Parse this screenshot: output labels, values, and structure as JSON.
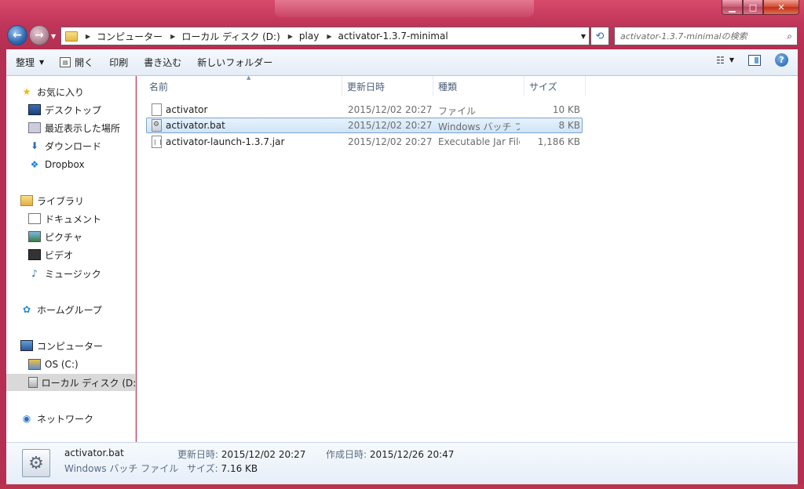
{
  "address": {
    "crumbs": [
      "コンピューター",
      "ローカル ディスク (D:)",
      "play",
      "activator-1.3.7-minimal"
    ]
  },
  "search": {
    "placeholder": "activator-1.3.7-minimalの検索"
  },
  "toolbar": {
    "organize": "整理",
    "open": "開く",
    "print": "印刷",
    "burn": "書き込む",
    "new_folder": "新しいフォルダー"
  },
  "nav": {
    "favorites": "お気に入り",
    "desktop": "デスクトップ",
    "recent": "最近表示した場所",
    "downloads": "ダウンロード",
    "dropbox": "Dropbox",
    "libraries": "ライブラリ",
    "documents": "ドキュメント",
    "pictures": "ピクチャ",
    "videos": "ビデオ",
    "music": "ミュージック",
    "homegroup": "ホームグループ",
    "computer": "コンピューター",
    "os_drive": "OS (C:)",
    "local_disk": "ローカル ディスク (D:)",
    "network": "ネットワーク"
  },
  "columns": {
    "name": "名前",
    "date": "更新日時",
    "type": "種類",
    "size": "サイズ"
  },
  "files": [
    {
      "name": "activator",
      "date": "2015/12/02 20:27",
      "type": "ファイル",
      "size": "10 KB",
      "icon": "generic-file-icon"
    },
    {
      "name": "activator.bat",
      "date": "2015/12/02 20:27",
      "type": "Windows バッチ ファイル",
      "size": "8 KB",
      "icon": "batch-file-icon"
    },
    {
      "name": "activator-launch-1.3.7.jar",
      "date": "2015/12/02 20:27",
      "type": "Executable Jar File",
      "size": "1,186 KB",
      "icon": "jar-file-icon"
    }
  ],
  "details": {
    "name": "activator.bat",
    "type": "Windows バッチ ファイル",
    "size_label": "サイズ:",
    "size_value": "7.16 KB",
    "modified_label": "更新日時:",
    "modified_value": "2015/12/02 20:27",
    "created_label": "作成日時:",
    "created_value": "2015/12/26 20:47"
  },
  "colors": {
    "frame": "#c0355a",
    "selection": "#cfe4f8",
    "selection_border": "#7ea4d0",
    "link_blue": "#1c5aa8"
  }
}
